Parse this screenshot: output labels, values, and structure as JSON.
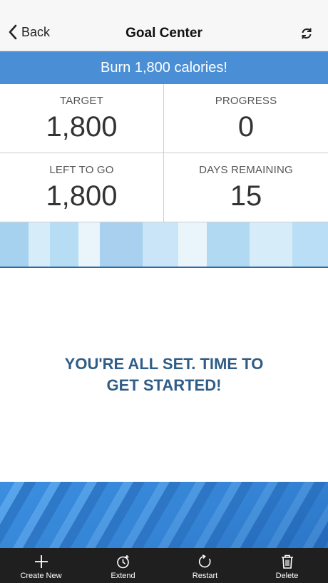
{
  "nav": {
    "back_label": "Back",
    "title": "Goal Center",
    "refresh_icon": "refresh-icon"
  },
  "banner": {
    "text": "Burn 1,800 calories!"
  },
  "stats": [
    {
      "label": "TARGET",
      "value": "1,800"
    },
    {
      "label": "PROGRESS",
      "value": "0"
    },
    {
      "label": "LEFT TO GO",
      "value": "1,800"
    },
    {
      "label": "DAYS REMAINING",
      "value": "15"
    }
  ],
  "message": {
    "line1": "YOU'RE ALL SET. TIME TO",
    "line2": "GET STARTED!"
  },
  "tabs": [
    {
      "label": "Create New",
      "icon": "plus-icon"
    },
    {
      "label": "Extend",
      "icon": "clock-plus-icon"
    },
    {
      "label": "Restart",
      "icon": "restart-icon"
    },
    {
      "label": "Delete",
      "icon": "trash-icon"
    }
  ],
  "colors": {
    "banner": "#4a8fd6",
    "message": "#2f5d87",
    "tabbar": "#1f1f1f"
  }
}
